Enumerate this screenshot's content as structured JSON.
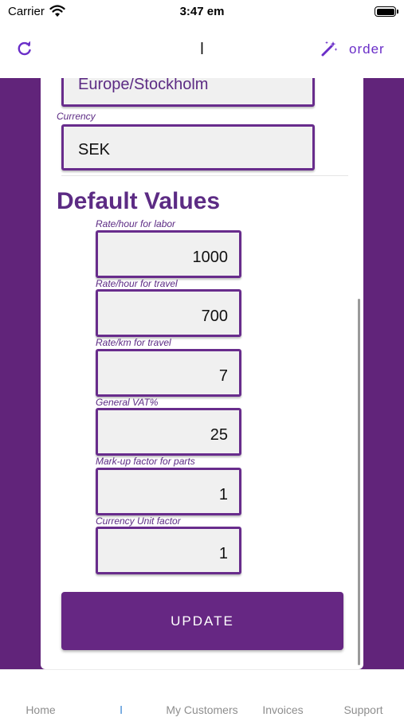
{
  "status_bar": {
    "carrier": "Carrier",
    "time": "3:47 em"
  },
  "nav": {
    "title": "l",
    "order_label": "order",
    "accent": "#6a2ec8"
  },
  "settings": {
    "timezone_value": "Europe/Stockholm",
    "currency_label": "Currency",
    "currency_value": "SEK",
    "section_title": "Default Values",
    "fields": [
      {
        "label": "Rate/hour for labor",
        "value": "1000"
      },
      {
        "label": "Rate/hour for travel",
        "value": "700"
      },
      {
        "label": "Rate/km for travel",
        "value": "7"
      },
      {
        "label": "General VAT%",
        "value": "25"
      },
      {
        "label": "Mark-up factor for parts",
        "value": "1"
      },
      {
        "label": "Currency Unit factor",
        "value": "1"
      }
    ],
    "update_label": "UPDATE"
  },
  "tabs": [
    {
      "label": "Home"
    },
    {
      "label": "l"
    },
    {
      "label": "My Customers"
    },
    {
      "label": "Invoices"
    },
    {
      "label": "Support"
    }
  ],
  "colors": {
    "brand_purple": "#61247a",
    "field_border": "#682c8c",
    "active_tab": "#2f7fd1"
  }
}
